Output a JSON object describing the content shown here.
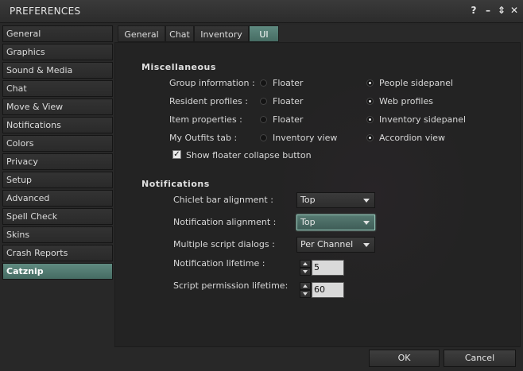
{
  "window": {
    "title": "PREFERENCES",
    "help_glyph": "?",
    "minimize_glyph": "–",
    "resize_glyph": "⇕",
    "close_glyph": "✕"
  },
  "sidebar": {
    "items": [
      {
        "label": "General"
      },
      {
        "label": "Graphics"
      },
      {
        "label": "Sound & Media"
      },
      {
        "label": "Chat"
      },
      {
        "label": "Move & View"
      },
      {
        "label": "Notifications"
      },
      {
        "label": "Colors"
      },
      {
        "label": "Privacy"
      },
      {
        "label": "Setup"
      },
      {
        "label": "Advanced"
      },
      {
        "label": "Spell Check"
      },
      {
        "label": "Skins"
      },
      {
        "label": "Crash Reports"
      },
      {
        "label": "Catznip"
      }
    ],
    "selected": "Catznip"
  },
  "tabs": [
    {
      "label": "General"
    },
    {
      "label": "Chat"
    },
    {
      "label": "Inventory"
    },
    {
      "label": "UI"
    }
  ],
  "selected_tab": "UI",
  "misc": {
    "heading": "Miscellaneous",
    "rows": [
      {
        "label": "Group information :",
        "option1": "Floater",
        "option2": "People sidepanel",
        "selected": 2
      },
      {
        "label": "Resident profiles :",
        "option1": "Floater",
        "option2": "Web profiles",
        "selected": 2
      },
      {
        "label": "Item properties :",
        "option1": "Floater",
        "option2": "Inventory sidepanel",
        "selected": 2
      },
      {
        "label": "My Outfits tab :",
        "option1": "Inventory view",
        "option2": "Accordion view",
        "selected": 2
      }
    ],
    "checkbox_label": "Show floater collapse button",
    "checkbox_checked": true,
    "checkbox_mark": "✓"
  },
  "notifications": {
    "heading": "Notifications",
    "chiclet_label": "Chiclet bar alignment :",
    "chiclet_value": "Top",
    "alignment_label": "Notification alignment :",
    "alignment_value": "Top",
    "script_dialogs_label": "Multiple script dialogs :",
    "script_dialogs_value": "Per Channel",
    "lifetime_label": "Notification lifetime :",
    "lifetime_value": "5",
    "script_perm_label": "Script permission lifetime:",
    "script_perm_value": "60"
  },
  "footer": {
    "ok_label": "OK",
    "cancel_label": "Cancel"
  }
}
